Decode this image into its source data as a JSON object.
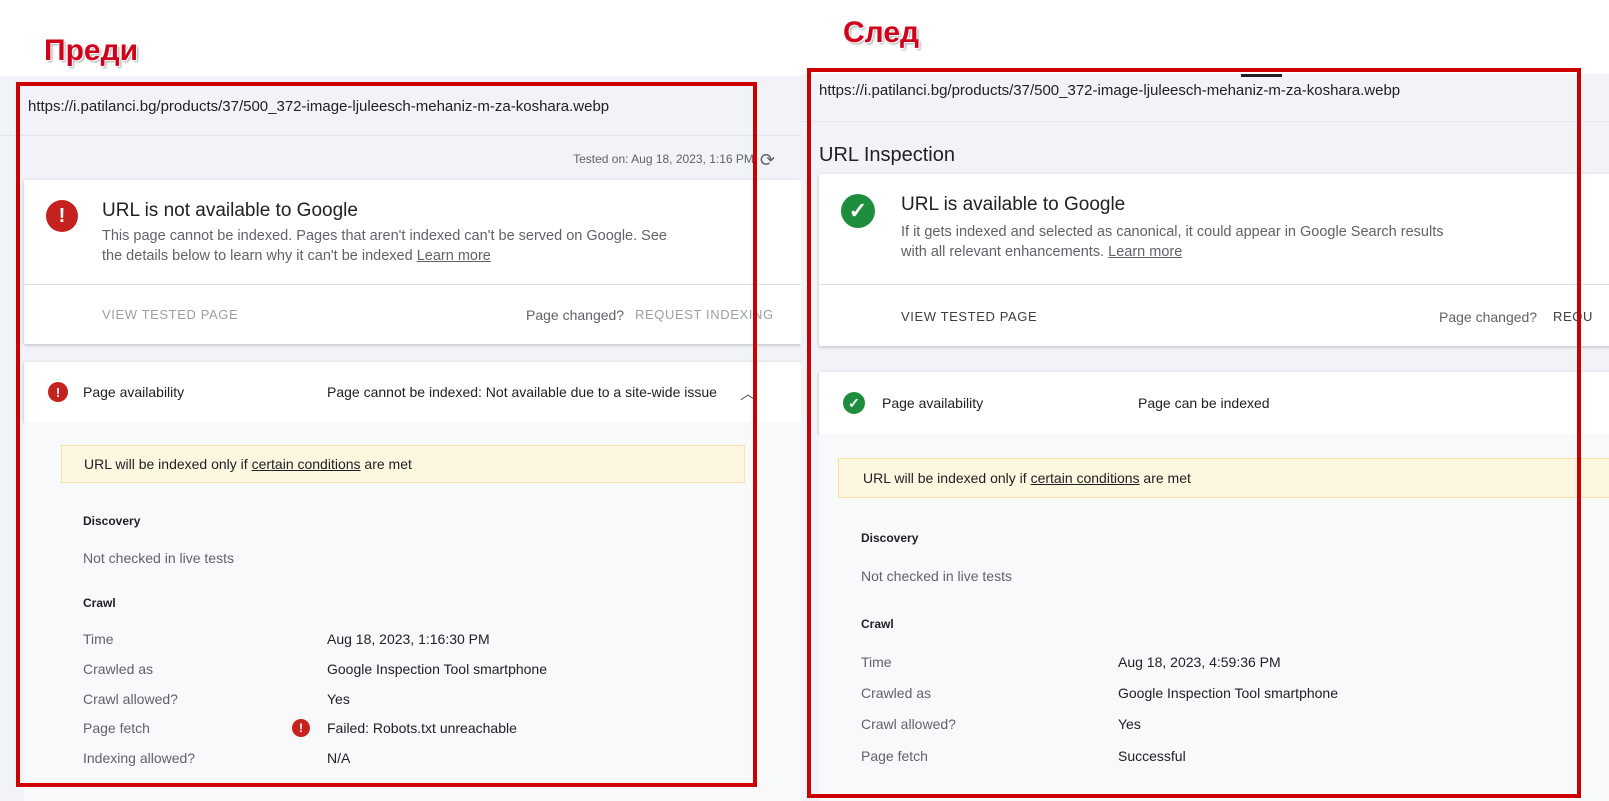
{
  "labels": {
    "before": "Преди",
    "after": "След"
  },
  "before": {
    "url": "https://i.patilanci.bg/products/37/500_372-image-ljuleesch-mehaniz-m-za-koshara.webp",
    "tested_on": "Tested on: Aug 18, 2023, 1:16 PM",
    "status_title": "URL is not available to Google",
    "status_desc_1": "This page cannot be indexed. Pages that aren't indexed can't be served on Google. See",
    "status_desc_2": "the details below to learn why it can't be indexed",
    "learn_more": "Learn more",
    "view_tested_page": "VIEW TESTED PAGE",
    "page_changed": "Page changed?",
    "request_indexing": "REQUEST INDEXING",
    "availability_label": "Page availability",
    "availability_value": "Page cannot be indexed: Not available due to a site-wide issue",
    "notice_pre": "URL will be indexed only if",
    "notice_link": "certain conditions",
    "notice_post": "are met",
    "discovery_heading": "Discovery",
    "discovery_value": "Not checked in live tests",
    "crawl_heading": "Crawl",
    "crawl_rows": [
      {
        "label": "Time",
        "value": "Aug 18, 2023, 1:16:30 PM"
      },
      {
        "label": "Crawled as",
        "value": "Google Inspection Tool smartphone"
      },
      {
        "label": "Crawl allowed?",
        "value": "Yes"
      },
      {
        "label": "Page fetch",
        "value": "Failed: Robots.txt unreachable"
      },
      {
        "label": "Indexing allowed?",
        "value": "N/A"
      }
    ]
  },
  "after": {
    "url": "https://i.patilanci.bg/products/37/500_372-image-ljuleesch-mehaniz-m-za-koshara.webp",
    "page_title": "URL Inspection",
    "status_title": "URL is available to Google",
    "status_desc_1": "If it gets indexed and selected as canonical, it could appear in Google Search results",
    "status_desc_2": "with all relevant enhancements.",
    "learn_more": "Learn more",
    "view_tested_page": "VIEW TESTED PAGE",
    "page_changed": "Page changed?",
    "request_indexing": "REQU",
    "availability_label": "Page availability",
    "availability_value": "Page can be indexed",
    "notice_pre": "URL will be indexed only if",
    "notice_link": "certain conditions",
    "notice_post": "are met",
    "discovery_heading": "Discovery",
    "discovery_value": "Not checked in live tests",
    "crawl_heading": "Crawl",
    "crawl_rows": [
      {
        "label": "Time",
        "value": "Aug 18, 2023, 4:59:36 PM"
      },
      {
        "label": "Crawled as",
        "value": "Google Inspection Tool smartphone"
      },
      {
        "label": "Crawl allowed?",
        "value": "Yes"
      },
      {
        "label": "Page fetch",
        "value": "Successful"
      }
    ]
  },
  "colors": {
    "frame": "#cc0000",
    "label": "#d0021b",
    "error": "#c5221f",
    "success": "#1e8e3e"
  },
  "icons": {
    "error": "error-icon",
    "success": "check-circle-icon",
    "refresh": "refresh-icon",
    "chevron": "chevron-up-icon"
  }
}
